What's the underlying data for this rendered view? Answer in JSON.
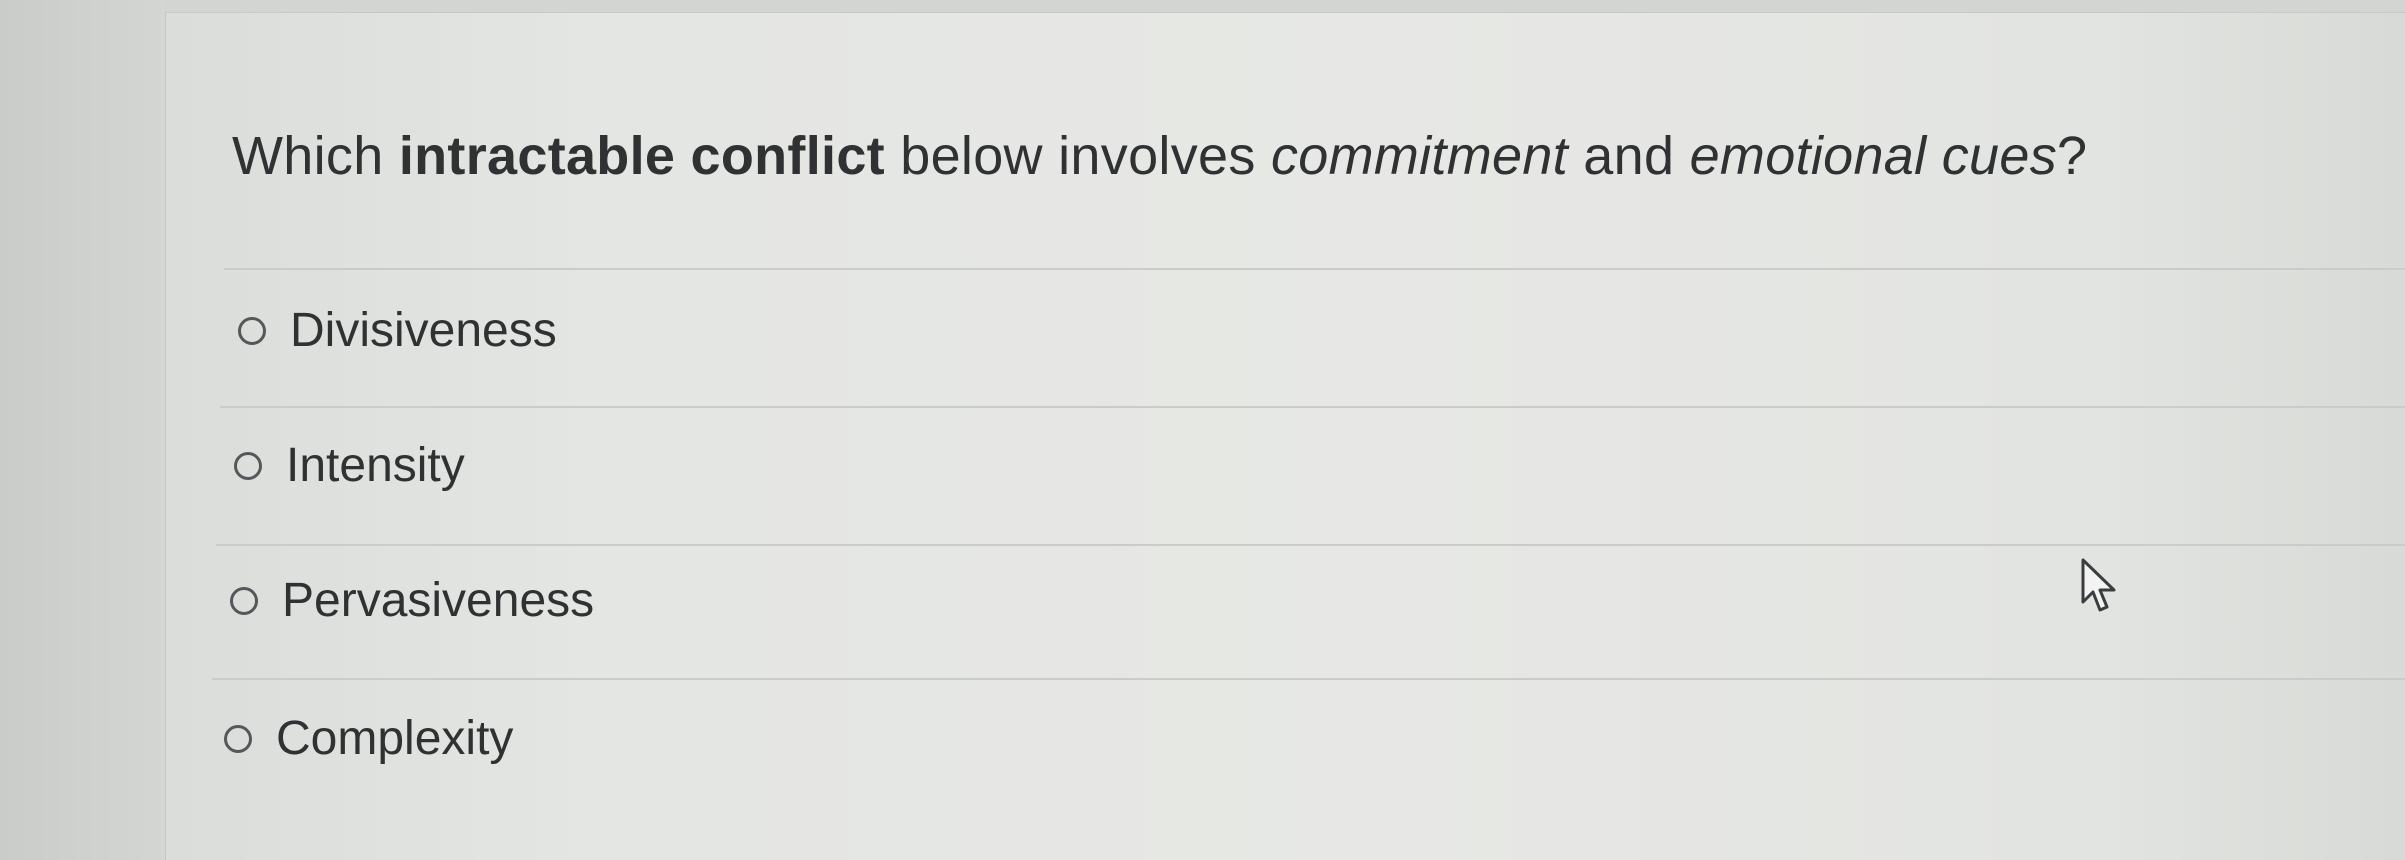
{
  "question": {
    "part1": "Which ",
    "bold": "intractable conflict",
    "part2": " below involves ",
    "italic1": "commitment",
    "part3": " and ",
    "italic2": "emotional cues",
    "part4": "?"
  },
  "options": [
    {
      "label": "Divisiveness",
      "selected": false
    },
    {
      "label": "Intensity",
      "selected": false
    },
    {
      "label": "Pervasiveness",
      "selected": false
    },
    {
      "label": "Complexity",
      "selected": false
    }
  ],
  "icons": {
    "radio": "radio-unchecked-icon",
    "cursor": "mouse-pointer-icon"
  },
  "colors": {
    "text": "#2f3133",
    "radio_border": "#55585b",
    "divider": "#c9ccc9"
  }
}
